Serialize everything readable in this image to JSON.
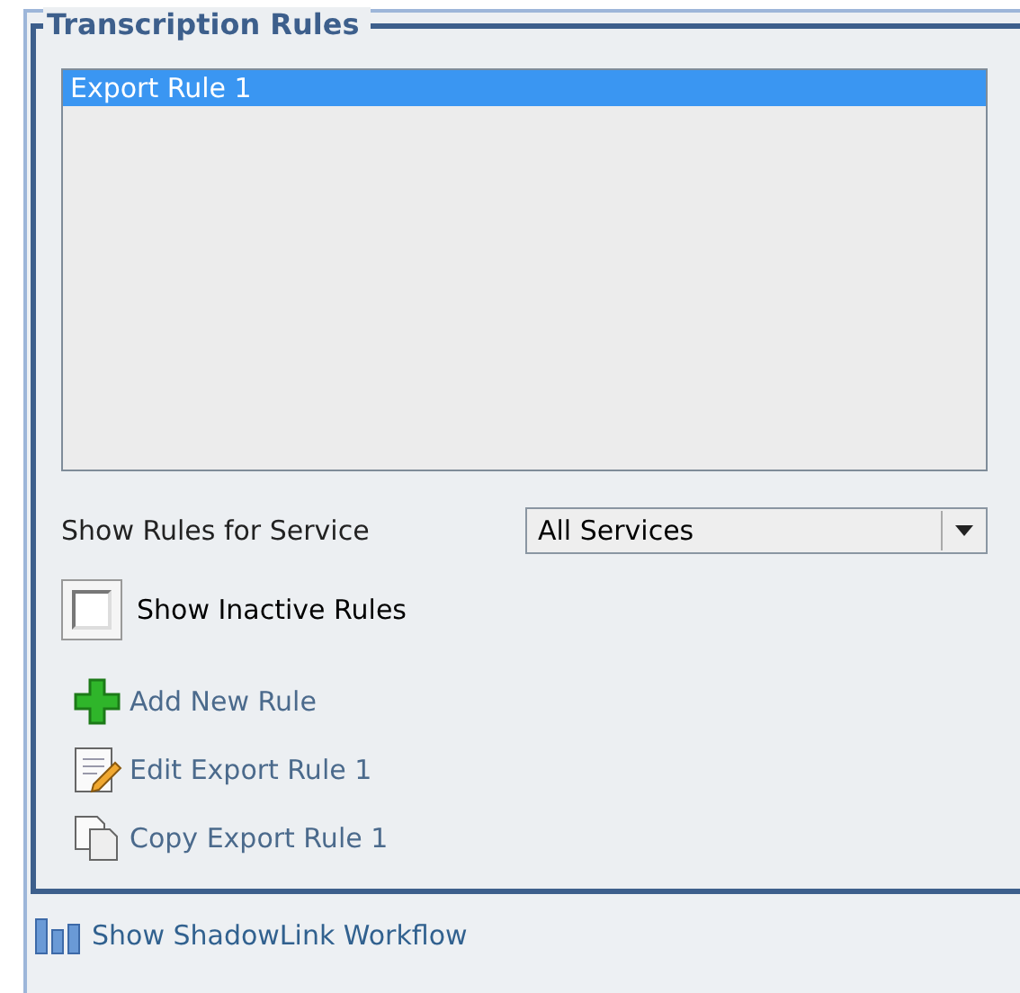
{
  "panel": {
    "title": "Transcription Rules",
    "rules": [
      {
        "label": "Export Rule 1",
        "selected": true
      }
    ],
    "service_filter": {
      "label": "Show Rules for Service",
      "value": "All Services"
    },
    "show_inactive": {
      "label": "Show Inactive Rules",
      "checked": false
    },
    "actions": [
      {
        "kind": "add",
        "label": "Add New Rule"
      },
      {
        "kind": "edit",
        "label": "Edit Export Rule 1"
      },
      {
        "kind": "copy",
        "label": "Copy Export Rule 1"
      }
    ]
  },
  "workflow_link": {
    "label": "Show ShadowLink Workflow"
  }
}
